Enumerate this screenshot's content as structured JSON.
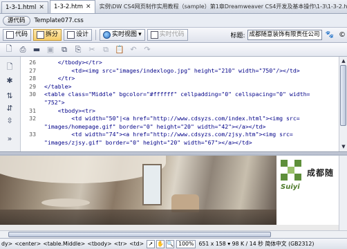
{
  "tabs": [
    {
      "label": "1-3-1.html",
      "active": false
    },
    {
      "label": "1-3-2.htm",
      "active": true
    }
  ],
  "tab_path": "实例\\DW CS4网页制作实用教程（sample）第1章Dreamweaver CS4开发及基本操作\\1-3\\1-3-2.htm",
  "related": {
    "source_code_label": "源代码",
    "file": "Template077.css"
  },
  "document_toolbar": {
    "code_label": "代码",
    "split_label": "拆分",
    "design_label": "设计",
    "live_view_label": "实时视图",
    "live_code_label": "实时代码",
    "title_label": "标题:",
    "title_value": "成都随意装饰有限责任公司"
  },
  "code": {
    "lines": [
      {
        "n": "26",
        "text": "    </tbody></tr>"
      },
      {
        "n": "27",
        "text": "        <td><img src=\"images/indexlogo.jpg\" height=\"210\" width=\"750\"/></td>"
      },
      {
        "n": "28",
        "text": "    </tr>"
      },
      {
        "n": "29",
        "text": "</table>"
      },
      {
        "n": "30",
        "text": "<table class=\"Middle\" bgcolor=\"#ffffff\" cellpadding=\"0\" cellspacing=\"0\" width="
      },
      {
        "n": "",
        "text": "\"752\">"
      },
      {
        "n": "31",
        "text": "    <tbody><tr>"
      },
      {
        "n": "32",
        "text": "        <td width=\"50\"|<a href=\"http://www.cdsyzs.com/index.html\"><img src="
      },
      {
        "n": "",
        "text": "\"images/homepage.gif\" border=\"0\" height=\"20\" width=\"42\"></a></td>"
      },
      {
        "n": "33",
        "text": "        <td width=\"74\"><a href=\"http://www.cdsyzs.com/zjsy.htm\"><img src="
      },
      {
        "n": "",
        "text": "\"images/zjsy.gif\" border=\"0\" height=\"20\" width=\"67\"></a></td>"
      }
    ]
  },
  "design": {
    "logo_text": "成都随",
    "logo_sub": "Suiyi"
  },
  "status": {
    "tags": [
      "dy>",
      "<center>",
      "<table.Middle>",
      "<tbody>",
      "<tr>",
      "<td>"
    ],
    "zoom": "100%",
    "info": "651 x 158 ▾ 98 K / 14 秒  简体中文 (GB2312)"
  }
}
